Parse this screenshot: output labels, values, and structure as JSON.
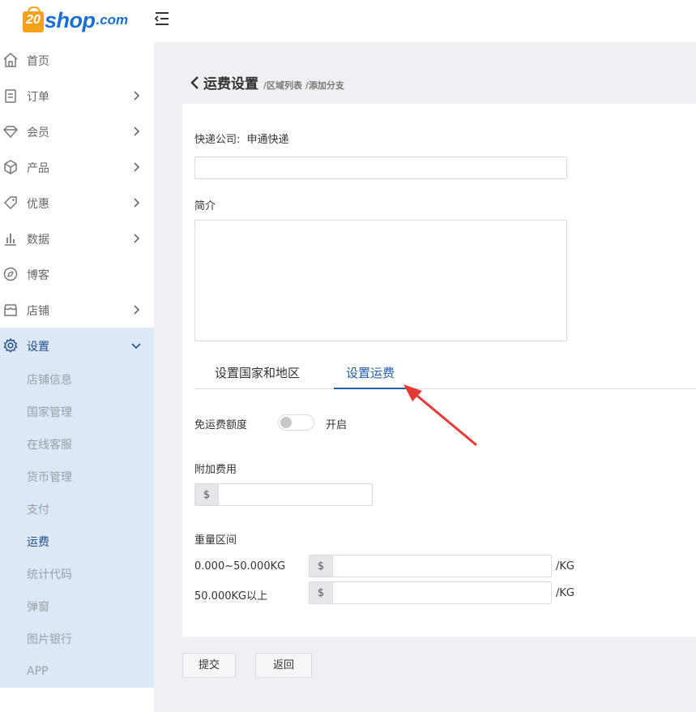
{
  "header": {
    "logo_mark": "20",
    "logo_text": "shop",
    "logo_suffix": ".com"
  },
  "sidebar": {
    "items": [
      {
        "label": "首页",
        "icon": "home-icon",
        "has_chevron": false
      },
      {
        "label": "订单",
        "icon": "clipboard-icon",
        "has_chevron": true
      },
      {
        "label": "会员",
        "icon": "diamond-icon",
        "has_chevron": true
      },
      {
        "label": "产品",
        "icon": "cube-icon",
        "has_chevron": true
      },
      {
        "label": "优惠",
        "icon": "tag-icon",
        "has_chevron": true
      },
      {
        "label": "数据",
        "icon": "bar-chart-icon",
        "has_chevron": true
      },
      {
        "label": "博客",
        "icon": "blog-icon",
        "has_chevron": false
      },
      {
        "label": "店铺",
        "icon": "store-icon",
        "has_chevron": true
      },
      {
        "label": "设置",
        "icon": "gear-icon",
        "has_chevron": true,
        "expanded": true
      }
    ],
    "submenu": [
      {
        "label": "店铺信息"
      },
      {
        "label": "国家管理"
      },
      {
        "label": "在线客服"
      },
      {
        "label": "货币管理"
      },
      {
        "label": "支付"
      },
      {
        "label": "运费",
        "active": true
      },
      {
        "label": "统计代码"
      },
      {
        "label": "弹窗"
      },
      {
        "label": "图片银行"
      },
      {
        "label": "APP"
      }
    ],
    "colors": {
      "active_bg": "#dce8f5",
      "active_text": "#1f4e8c"
    }
  },
  "page": {
    "title": "运费设置",
    "breadcrumb": "/区域列表 /添加分支"
  },
  "form": {
    "company_label": "快递公司:",
    "company_value": "申通快递",
    "company_input_value": "",
    "intro_label": "简介",
    "intro_value": "",
    "tabs": [
      {
        "label": "设置国家和地区",
        "active": false
      },
      {
        "label": "设置运费",
        "active": true
      }
    ],
    "free_shipping_label": "免运费额度",
    "free_shipping_toggle_label": "开启",
    "free_shipping_enabled": false,
    "extra_fee_label": "附加费用",
    "currency_prefix": "$",
    "extra_fee_value": "",
    "weight_range_label": "重量区间",
    "weight_ranges": [
      {
        "range": "0.000~50.000KG",
        "prefix": "$",
        "value": "",
        "unit": "/KG"
      },
      {
        "range": "50.000KG以上",
        "prefix": "$",
        "value": "",
        "unit": "/KG"
      }
    ]
  },
  "actions": {
    "submit_label": "提交",
    "back_label": "返回"
  },
  "accent_color": "#1f5fa8",
  "annotation_color": "#e53935"
}
